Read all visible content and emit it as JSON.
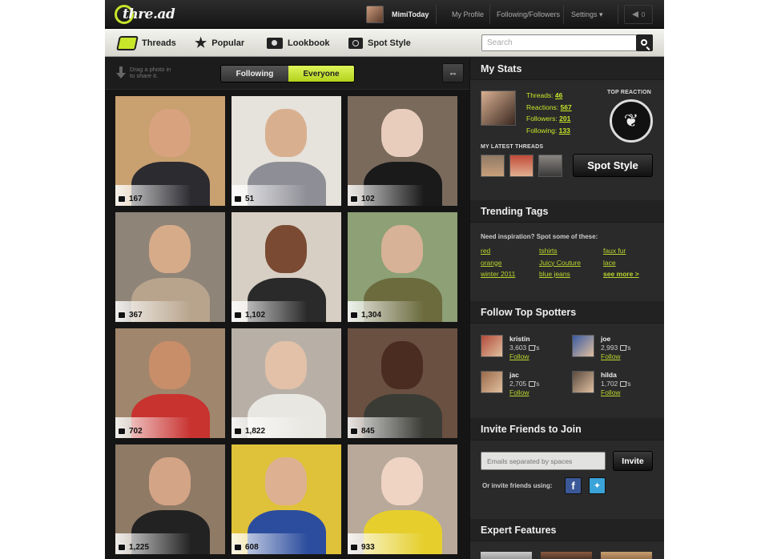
{
  "app": {
    "logo_text": "thre.ad"
  },
  "topbar": {
    "username": "MimiToday",
    "my_profile": "My Profile",
    "following_followers": "Following/Followers",
    "settings": "Settings ▾",
    "message_count": "0"
  },
  "nav": {
    "tabs": [
      {
        "label": "Threads",
        "icon": "threads-icon"
      },
      {
        "label": "Popular",
        "icon": "star-icon"
      },
      {
        "label": "Lookbook",
        "icon": "lookbook-icon"
      },
      {
        "label": "Spot Style",
        "icon": "camera-icon"
      }
    ],
    "search_placeholder": "Search"
  },
  "feed": {
    "drop_hint": "Drag a photo in to share it.",
    "filter_following": "Following",
    "filter_everyone": "Everyone",
    "swap_symbol": "⇔",
    "photos": [
      {
        "count": "167",
        "bg": "#c9a070",
        "skin": "#d8a27f",
        "body": "#2b2b30"
      },
      {
        "count": "51",
        "bg": "#e6e2dc",
        "skin": "#d9b08f",
        "body": "#8e8f96"
      },
      {
        "count": "102",
        "bg": "#7a6a5c",
        "skin": "#e8cdbd",
        "body": "#1a1a1a"
      },
      {
        "count": "367",
        "bg": "#8f8478",
        "skin": "#d6ab8a",
        "body": "#b8a48c"
      },
      {
        "count": "1,102",
        "bg": "#d8cfc4",
        "skin": "#7a4a33",
        "body": "#2a2a2a"
      },
      {
        "count": "1,304",
        "bg": "#8da076",
        "skin": "#d7b296",
        "body": "#6b6b3e"
      },
      {
        "count": "702",
        "bg": "#a0866c",
        "skin": "#c88e6a",
        "body": "#c8322f"
      },
      {
        "count": "1,822",
        "bg": "#b8b0a6",
        "skin": "#e2c1a8",
        "body": "#e9e7e2"
      },
      {
        "count": "845",
        "bg": "#6a5040",
        "skin": "#4a2c20",
        "body": "#3b3b36"
      },
      {
        "count": "1,225",
        "bg": "#8f7a66",
        "skin": "#d4a486",
        "body": "#222"
      },
      {
        "count": "608",
        "bg": "#e0c23a",
        "skin": "#dcb090",
        "body": "#2c4d9e"
      },
      {
        "count": "933",
        "bg": "#b9a99a",
        "skin": "#efd4c4",
        "body": "#e6cf2d"
      }
    ]
  },
  "sidebar": {
    "my_stats": {
      "title": "My Stats",
      "threads_label": "Threads:",
      "threads": "46",
      "reactions_label": "Reactions:",
      "reactions": "567",
      "followers_label": "Followers:",
      "followers": "201",
      "following_label": "Following:",
      "following": "133",
      "top_reaction_label": "TOP REACTION",
      "latest_threads_label": "MY LATEST THREADS",
      "spot_style_button": "Spot Style"
    },
    "trending": {
      "title": "Trending Tags",
      "intro": "Need inspiration? Spot some of these:",
      "tags": [
        [
          "red",
          "tshirts",
          "faux fur"
        ],
        [
          "orange",
          "Juicy Couture",
          "lace"
        ],
        [
          "winter 2011",
          "blue jeans",
          "see more >"
        ]
      ]
    },
    "spotters": {
      "title": "Follow Top Spotters",
      "people": [
        {
          "name": "kristin",
          "points": "3,603",
          "suffix": "'s",
          "follow": "Follow",
          "color": "#b24a3a"
        },
        {
          "name": "joe",
          "points": "2,993",
          "suffix": "'s",
          "follow": "Follow",
          "color": "#3a5aa0"
        },
        {
          "name": "jac",
          "points": "2,705",
          "suffix": "'s",
          "follow": "Follow",
          "color": "#9a6a4a"
        },
        {
          "name": "hilda",
          "points": "1,702",
          "suffix": "'s",
          "follow": "Follow",
          "color": "#5a4a40"
        }
      ]
    },
    "invite": {
      "title": "Invite Friends to Join",
      "email_placeholder": "Emails separated by spaces",
      "invite_button": "Invite",
      "or_text": "Or invite friends using:"
    },
    "expert": {
      "title": "Expert Features"
    }
  },
  "colors": {
    "accent": "#c8e62a",
    "link": "#b9d72e",
    "panel": "#2a2a2a"
  }
}
